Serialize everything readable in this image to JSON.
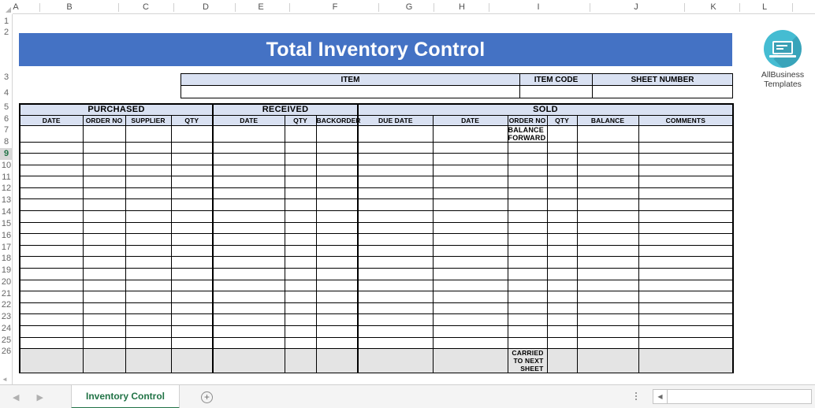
{
  "app": {
    "type": "spreadsheet",
    "accent_color": "#4472C4",
    "header_fill": "#D9E1F2",
    "tab_color": "#217346"
  },
  "grid": {
    "column_letters": [
      "A",
      "B",
      "C",
      "D",
      "E",
      "F",
      "G",
      "H",
      "I",
      "J",
      "K",
      "L"
    ],
    "row_numbers": [
      "1",
      "2",
      "3",
      "4",
      "5",
      "6",
      "7",
      "8",
      "9",
      "10",
      "11",
      "12",
      "13",
      "14",
      "15",
      "16",
      "17",
      "18",
      "19",
      "20",
      "21",
      "22",
      "23",
      "24",
      "25",
      "26"
    ],
    "active_row": "9"
  },
  "title_banner": {
    "text": "Total Inventory Control"
  },
  "logo": {
    "icon": "laptop-icon",
    "line1": "AllBusiness",
    "line2": "Templates"
  },
  "item_block": {
    "headers": [
      "ITEM",
      "ITEM CODE",
      "SHEET NUMBER"
    ],
    "values": [
      "",
      "",
      ""
    ]
  },
  "table": {
    "groups": [
      {
        "label": "PURCHASED",
        "span": 4
      },
      {
        "label": "RECEIVED",
        "span": 3
      },
      {
        "label": "SOLD",
        "span": 6
      }
    ],
    "subheaders": [
      "DATE",
      "ORDER NO",
      "SUPPLIER",
      "QTY",
      "DATE",
      "QTY",
      "BACKORDER",
      "DUE DATE",
      "DATE",
      "ORDER NO",
      "QTY",
      "BALANCE",
      "COMMENTS"
    ],
    "balance_forward_label": "BALANCE FORWARD",
    "carried_label": "CARRIED TO NEXT SHEET",
    "empty_data_rows": 18
  },
  "bottom_bar": {
    "prev_arrow": "◀",
    "next_arrow": "▶",
    "sheet_tab": "Inventory Control",
    "add_sheet": "+",
    "scroll_left_arrow": "◀"
  }
}
